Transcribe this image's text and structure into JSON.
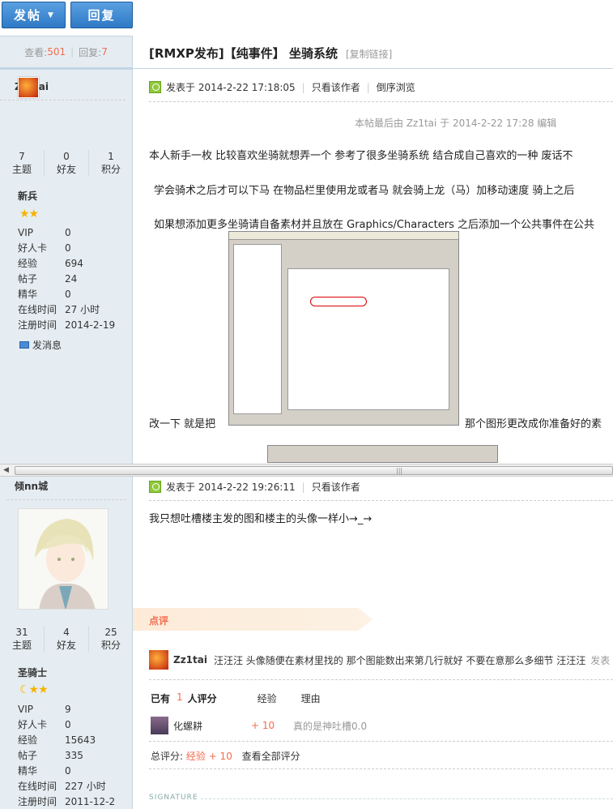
{
  "toolbar": {
    "post_label": "发帖",
    "reply_label": "回复"
  },
  "thread": {
    "views_label": "查看:",
    "views": "501",
    "replies_label": "回复:",
    "replies": "7",
    "title": "[RMXP发布]【纯事件】 坐骑系统",
    "copy_link": "[复制链接]"
  },
  "post1": {
    "author": "Zz1tai",
    "stats": [
      {
        "num": "7",
        "label": "主题"
      },
      {
        "num": "0",
        "label": "好友"
      },
      {
        "num": "1",
        "label": "积分"
      }
    ],
    "rank": "新兵",
    "stars": "★★",
    "info": [
      {
        "k": "VIP",
        "v": "0"
      },
      {
        "k": "好人卡",
        "v": "0"
      },
      {
        "k": "经验",
        "v": "694"
      },
      {
        "k": "帖子",
        "v": "24"
      },
      {
        "k": "精华",
        "v": "0"
      },
      {
        "k": "在线时间",
        "v": "27 小时"
      },
      {
        "k": "注册时间",
        "v": "2014-2-19"
      }
    ],
    "send_msg": "发消息",
    "posted_label": "发表于",
    "posted_time": "2014-2-22 17:18:05",
    "only_author": "只看该作者",
    "reverse": "倒序浏览",
    "edited": "本帖最后由 Zz1tai 于 2014-2-22 17:28 编辑",
    "para1": "本人新手一枚 比较喜欢坐骑就想弄一个 参考了很多坐骑系统 结合成自己喜欢的一种 废话不",
    "para2": "学会骑术之后才可以下马 在物品栏里使用龙或者马 就会骑上龙（马）加移动速度 骑上之后",
    "para3": "如果想添加更多坐骑请自备素材并且放在 Graphics/Characters 之后添加一个公共事件在公共",
    "para4a": "改一下 就是把",
    "para4b": "那个图形更改成你准备好的素"
  },
  "post2": {
    "author": "倾nn城",
    "stats": [
      {
        "num": "31",
        "label": "主题"
      },
      {
        "num": "4",
        "label": "好友"
      },
      {
        "num": "25",
        "label": "积分"
      }
    ],
    "rank": "圣骑士",
    "stars": "☾★★",
    "info": [
      {
        "k": "VIP",
        "v": "9"
      },
      {
        "k": "好人卡",
        "v": "0"
      },
      {
        "k": "经验",
        "v": "15643"
      },
      {
        "k": "帖子",
        "v": "335"
      },
      {
        "k": "精华",
        "v": "0"
      },
      {
        "k": "在线时间",
        "v": "227 小时"
      },
      {
        "k": "注册时间",
        "v": "2011-12-2"
      }
    ],
    "posted_label": "发表于",
    "posted_time": "2014-2-22 19:26:11",
    "only_author": "只看该作者",
    "body": "我只想吐槽楼主发的图和楼主的头像一样小→_→",
    "dianping": "点评",
    "comment_user": "Zz1tai",
    "comment_text": "汪汪汪 头像随便在素材里找的 那个图能数出来第几行就好 不要在意那么多细节 汪汪汪",
    "comment_time": "发表",
    "rate_has": "已有",
    "rate_count": "1",
    "rate_people": "人评分",
    "rate_col_exp": "经验",
    "rate_col_reason": "理由",
    "rater_name": "化螺耕",
    "rater_exp": "+ 10",
    "rater_reason": "真的是神吐槽0.0",
    "total_label": "总评分:",
    "total_exp": "经验 + 10",
    "view_all": "查看全部评分",
    "signature": "SIGNATURE"
  },
  "colors": {
    "accent": "#f26c4f",
    "blue": "#2f79c6",
    "sidebar": "#e5edf2"
  }
}
